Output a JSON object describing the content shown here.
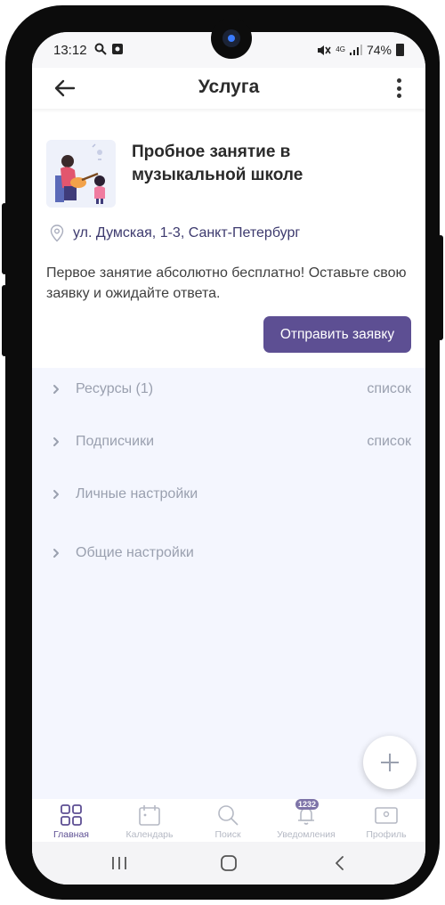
{
  "status_bar": {
    "time": "13:12",
    "network": "4G",
    "battery": "74%"
  },
  "header": {
    "title": "Услуга",
    "back_icon": "arrow-left-icon",
    "menu_icon": "more-vertical-icon"
  },
  "service": {
    "title": "Пробное занятие в музыкальной школе",
    "address": "ул. Думская, 1-3, Санкт-Петербург",
    "description": "Первое занятие абсолютно бесплатно! Оставьте свою заявку и ожидайте ответа.",
    "submit_label": "Отправить заявку"
  },
  "sections": [
    {
      "label": "Ресурсы (1)",
      "link": "список"
    },
    {
      "label": "Подписчики",
      "link": "список"
    },
    {
      "label": "Личные настройки",
      "link": ""
    },
    {
      "label": "Общие настройки",
      "link": ""
    }
  ],
  "bottom_nav": [
    {
      "label": "Главная",
      "icon": "grid-icon",
      "active": true
    },
    {
      "label": "Календарь",
      "icon": "calendar-icon",
      "active": false
    },
    {
      "label": "Поиск",
      "icon": "search-icon",
      "active": false
    },
    {
      "label": "Уведомления",
      "icon": "bell-icon",
      "badge": "1232",
      "active": false
    },
    {
      "label": "Профиль",
      "icon": "profile-card-icon",
      "active": false
    }
  ],
  "colors": {
    "accent": "#5d4f93",
    "section_bg": "#f4f6fe",
    "muted_text": "#9aa0af"
  }
}
